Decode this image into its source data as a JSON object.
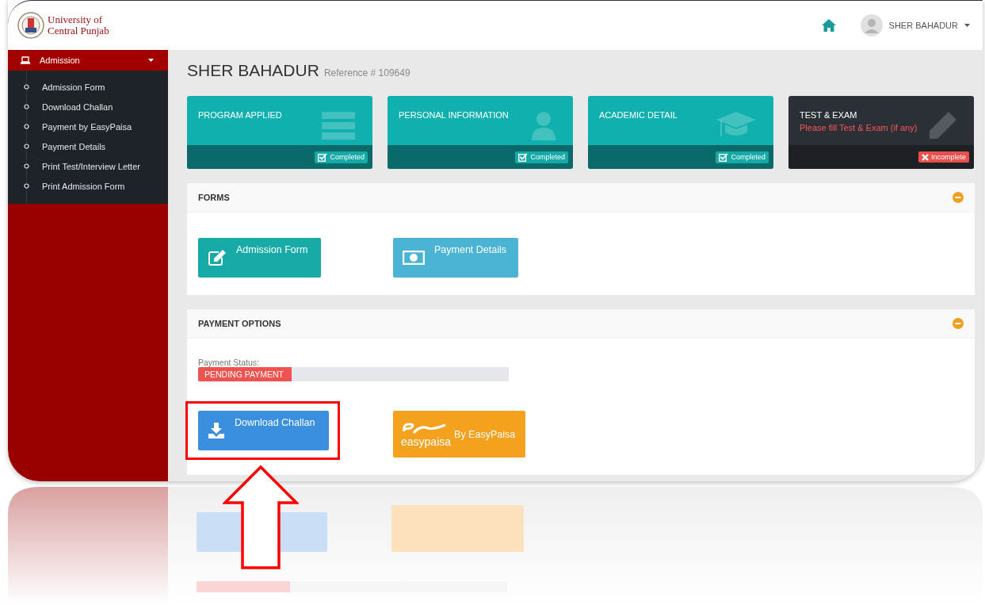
{
  "header": {
    "logo_lines": [
      "University of",
      "Central Punjab"
    ],
    "user_name": "SHER BAHADUR"
  },
  "sidebar": {
    "section": {
      "label": "Admission",
      "expanded": true
    },
    "items": [
      {
        "label": "Admission Form"
      },
      {
        "label": "Download Challan"
      },
      {
        "label": "Payment by EasyPaisa"
      },
      {
        "label": "Payment Details"
      },
      {
        "label": "Print Test/Interview Letter"
      },
      {
        "label": "Print Admission Form"
      }
    ]
  },
  "page": {
    "title": "SHER BAHADUR",
    "reference": "Reference # 109649"
  },
  "cards": [
    {
      "title": "PROGRAM APPLIED",
      "kind": "completed",
      "badge": "Completed"
    },
    {
      "title": "PERSONAL INFORMATION",
      "kind": "completed",
      "badge": "Completed"
    },
    {
      "title": "ACADEMIC DETAIL",
      "kind": "completed",
      "badge": "Completed"
    },
    {
      "title": "TEST & EXAM",
      "note": "Please fill Test & Exam (if any)",
      "kind": "incomplete",
      "badge": "Incomplete"
    }
  ],
  "forms_panel": {
    "title": "FORMS",
    "expanded": true,
    "buttons": [
      {
        "label": "Admission Form"
      },
      {
        "label": "Payment Details"
      }
    ]
  },
  "payment_panel": {
    "title": "PAYMENT OPTIONS",
    "expanded": true,
    "status_label": "Payment Status:",
    "progress": {
      "level": 0.3,
      "text": "PENDING PAYMENT"
    },
    "buttons": [
      {
        "label": "Download Challan",
        "highlighted": true
      },
      {
        "label": "By EasyPaisa",
        "logo_text": "easypaisa"
      }
    ]
  }
}
